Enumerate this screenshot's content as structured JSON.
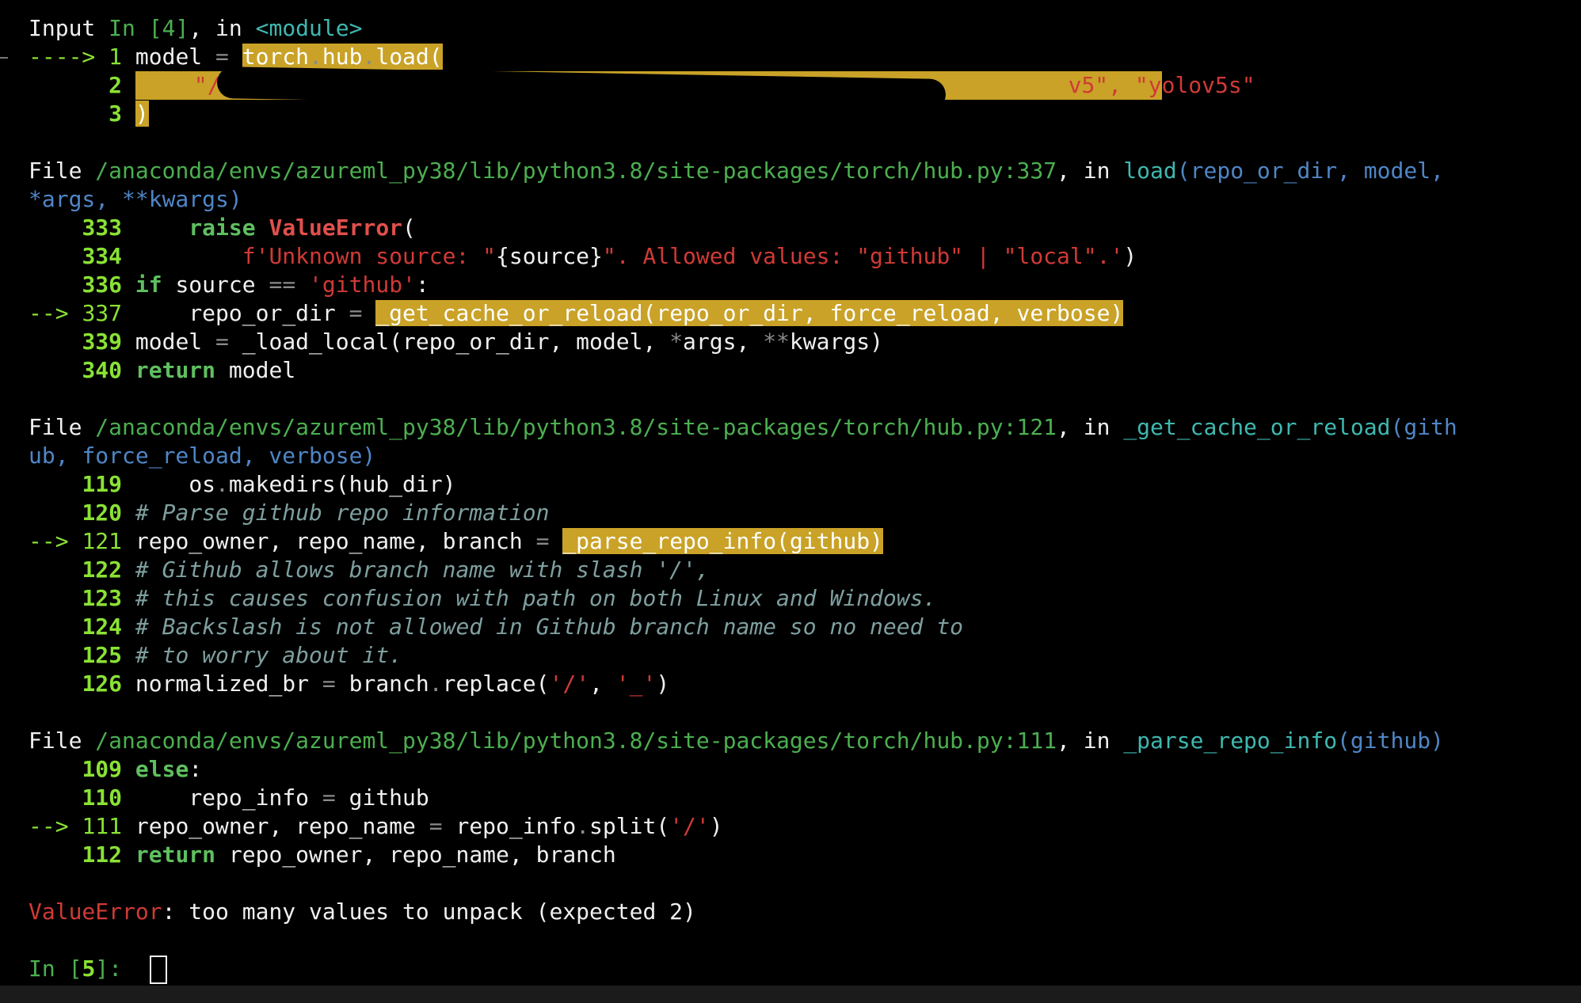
{
  "cell1": {
    "input_label": "Input",
    "in_label": "In [4]",
    "in_module": ", in ",
    "module": "<module>",
    "lines": [
      {
        "marker": "----> ",
        "num": "1",
        "code": "model = torch.hub.load("
      },
      {
        "marker": "      ",
        "num": "2",
        "code": "\"/ ... v5\", \"yolov5s\""
      },
      {
        "marker": "      ",
        "num": "3",
        "code": ")"
      }
    ]
  },
  "frame1": {
    "file_label": "File ",
    "path": "/anaconda/envs/azureml_py38/lib/python3.8/site-packages/torch/hub.py:337",
    "in_text": ", in ",
    "func": "load",
    "args1": "(repo_or_dir, model,",
    "args2": "*args, **kwargs)",
    "l333": "333",
    "l334": "334",
    "l336": "336",
    "l337": "337",
    "l339": "339",
    "l340": "340",
    "arrow": "--> "
  },
  "frame2": {
    "file_label": "File ",
    "path": "/anaconda/envs/azureml_py38/lib/python3.8/site-packages/torch/hub.py:121",
    "in_text": ", in ",
    "func": "_get_cache_or_reload",
    "args1": "(gith",
    "args2": "ub, force_reload, verbose)",
    "l119": "119",
    "l120": "120",
    "l121": "121",
    "l122": "122",
    "l123": "123",
    "l124": "124",
    "l125": "125",
    "l126": "126",
    "c120": "# Parse github repo information",
    "c122": "# Github allows branch name with slash '/',",
    "c123": "# this causes confusion with path on both Linux and Windows.",
    "c124": "# Backslash is not allowed in Github branch name so no need to",
    "c125": "# to worry about it.",
    "arrow": "--> "
  },
  "frame3": {
    "file_label": "File ",
    "path": "/anaconda/envs/azureml_py38/lib/python3.8/site-packages/torch/hub.py:111",
    "in_text": ", in ",
    "func": "_parse_repo_info",
    "args": "(github)",
    "l109": "109",
    "l110": "110",
    "l111": "111",
    "l112": "112",
    "arrow": "--> "
  },
  "error": {
    "type": "ValueError",
    "message": ": too many values to unpack (expected 2)"
  },
  "prompt": {
    "in": "In [",
    "num": "5",
    "close": "]: "
  }
}
